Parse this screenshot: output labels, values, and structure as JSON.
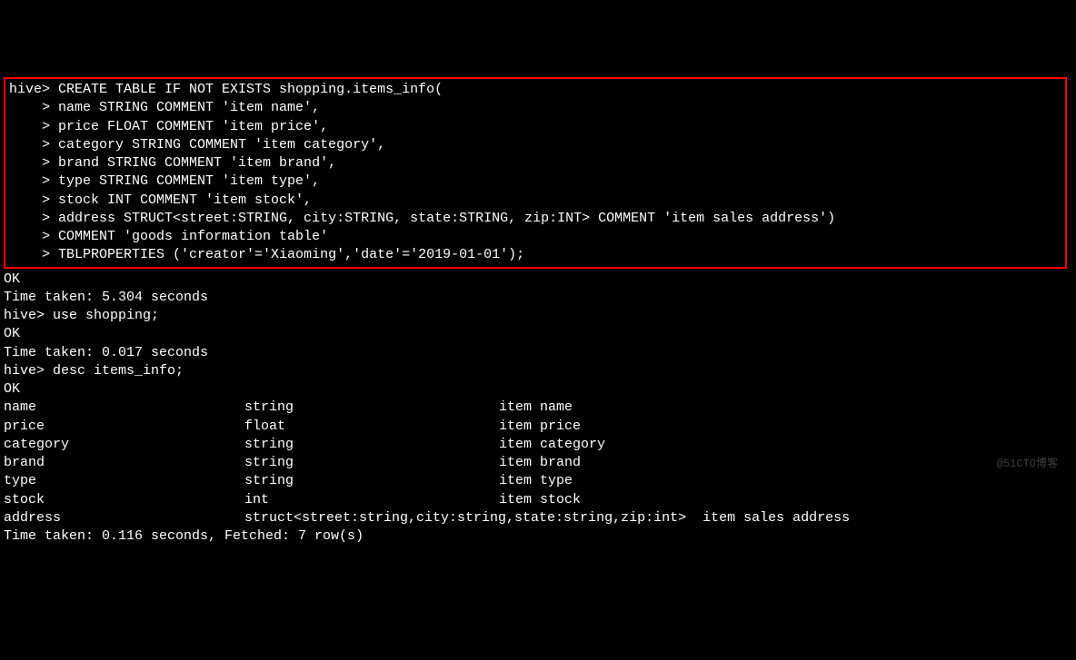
{
  "highlighted": {
    "prompt": "hive>",
    "cont_prompt": "    >",
    "lines": [
      " CREATE TABLE IF NOT EXISTS shopping.items_info(",
      " name STRING COMMENT 'item name',",
      " price FLOAT COMMENT 'item price',",
      " category STRING COMMENT 'item category',",
      " brand STRING COMMENT 'item brand',",
      " type STRING COMMENT 'item type',",
      " stock INT COMMENT 'item stock',",
      " address STRUCT<street:STRING, city:STRING, state:STRING, zip:INT> COMMENT 'item sales address')",
      " COMMENT 'goods information table'",
      " TBLPROPERTIES ('creator'='Xiaoming','date'='2019-01-01');"
    ]
  },
  "output_lines": [
    {
      "type": "plain",
      "text": "OK"
    },
    {
      "type": "plain",
      "text": "Time taken: 5.304 seconds"
    },
    {
      "type": "cmd",
      "prompt": "hive>",
      "text": " use shopping;"
    },
    {
      "type": "plain",
      "text": "OK"
    },
    {
      "type": "plain",
      "text": "Time taken: 0.017 seconds"
    },
    {
      "type": "cmd",
      "prompt": "hive>",
      "text": " desc items_info;"
    },
    {
      "type": "plain",
      "text": "OK"
    },
    {
      "type": "desc",
      "c1": "name",
      "c2": "string",
      "c3": "item name"
    },
    {
      "type": "desc",
      "c1": "price",
      "c2": "float",
      "c3": "item price"
    },
    {
      "type": "desc",
      "c1": "category",
      "c2": "string",
      "c3": "item category"
    },
    {
      "type": "desc",
      "c1": "brand",
      "c2": "string",
      "c3": "item brand"
    },
    {
      "type": "desc",
      "c1": "type",
      "c2": "string",
      "c3": "item type"
    },
    {
      "type": "desc",
      "c1": "stock",
      "c2": "int",
      "c3": "item stock"
    },
    {
      "type": "desc",
      "c1": "address",
      "c2": "struct<street:string,city:string,state:string,zip:int>  item sales address",
      "c3": ""
    },
    {
      "type": "plain",
      "text": "Time taken: 0.116 seconds, Fetched: 7 row(s)"
    }
  ],
  "watermark": "@51CTO博客"
}
